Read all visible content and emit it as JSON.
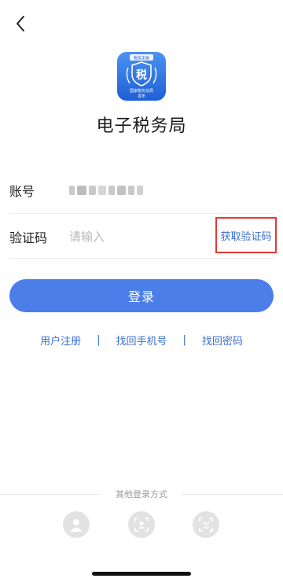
{
  "header": {
    "back_icon": "chevron-left-icon"
  },
  "app": {
    "title": "电子税务局",
    "logo": {
      "top_text": "税务手册",
      "glyph": "税",
      "line1": "国家税务总局",
      "line2": "发布"
    }
  },
  "form": {
    "account_label": "账号",
    "code_label": "验证码",
    "code_placeholder": "请输入",
    "get_code_label": "获取验证码"
  },
  "login_button": "登录",
  "links": {
    "register": "用户注册",
    "recover_phone": "找回手机号",
    "recover_password": "找回密码",
    "separator": "|"
  },
  "other_login": {
    "title": "其他登录方式",
    "methods": [
      "person-icon",
      "face-scan-icon",
      "face-id-icon"
    ]
  },
  "colors": {
    "primary": "#4b7ee8",
    "link": "#3b6fd0",
    "highlight_border": "#e53935"
  }
}
